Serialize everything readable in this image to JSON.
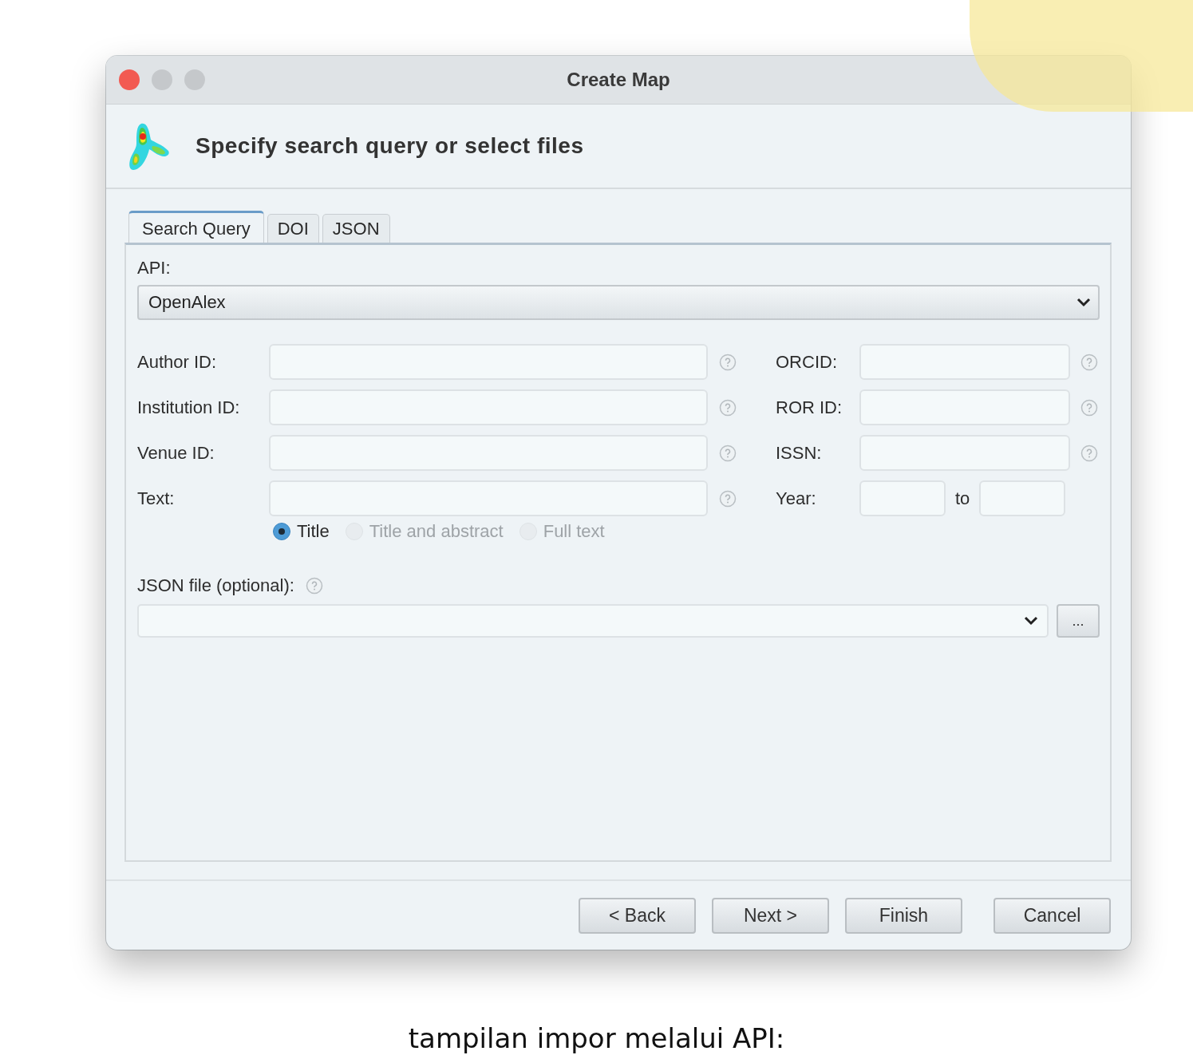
{
  "window": {
    "title": "Create Map"
  },
  "header": {
    "title": "Specify search query or select files"
  },
  "tabs": [
    {
      "label": "Search Query",
      "selected": true
    },
    {
      "label": "DOI",
      "selected": false
    },
    {
      "label": "JSON",
      "selected": false
    }
  ],
  "api": {
    "label": "API:",
    "value": "OpenAlex"
  },
  "left_fields": [
    {
      "label": "Author ID:"
    },
    {
      "label": "Institution ID:"
    },
    {
      "label": "Venue ID:"
    },
    {
      "label": "Text:"
    }
  ],
  "right_fields": [
    {
      "kind": "text",
      "label": "ORCID:"
    },
    {
      "kind": "text",
      "label": "ROR ID:"
    },
    {
      "kind": "text",
      "label": "ISSN:"
    },
    {
      "kind": "range",
      "label": "Year:",
      "separator": "to"
    }
  ],
  "text_scope": [
    {
      "label": "Title",
      "selected": true,
      "disabled": false
    },
    {
      "label": "Title and abstract",
      "selected": false,
      "disabled": true
    },
    {
      "label": "Full text",
      "selected": false,
      "disabled": true
    }
  ],
  "json_file": {
    "label": "JSON file (optional):",
    "browse": "..."
  },
  "buttons": [
    "< Back",
    "Next >",
    "Finish",
    "Cancel"
  ],
  "caption": "tampilan impor melalui API:"
}
